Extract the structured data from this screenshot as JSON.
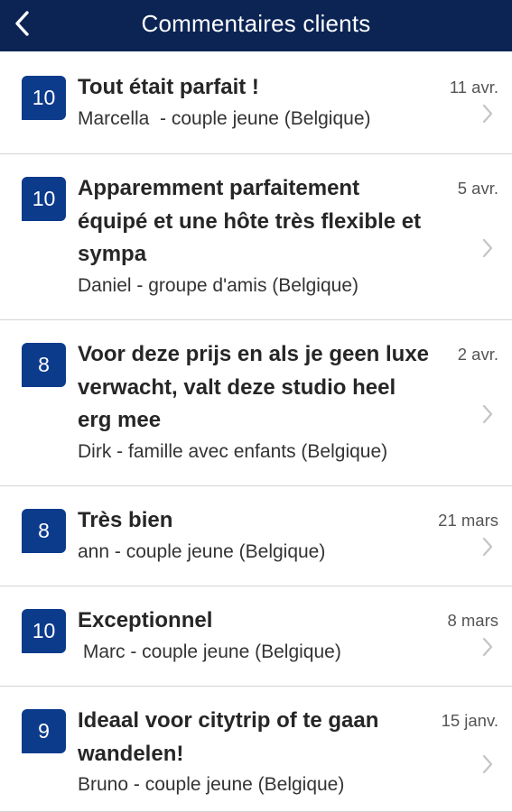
{
  "header": {
    "title": "Commentaires clients",
    "back_icon": "chevron-left-icon"
  },
  "colors": {
    "header_bg": "#0b2454",
    "score_bg": "#0d3b8c"
  },
  "reviews": [
    {
      "score": "10",
      "title": "Tout était parfait !",
      "author": "Marcella  - couple jeune (Belgique)",
      "date": "11 avr."
    },
    {
      "score": "10",
      "title": "Apparemment parfaitement équipé et une hôte très flexible et sympa",
      "author": "Daniel - groupe d'amis (Belgique)",
      "date": "5 avr."
    },
    {
      "score": "8",
      "title": "Voor deze prijs en als je geen luxe verwacht, valt deze studio heel erg mee",
      "author": "Dirk - famille avec enfants (Belgique)",
      "date": "2 avr."
    },
    {
      "score": "8",
      "title": "Très bien",
      "author": "ann - couple jeune (Belgique)",
      "date": "21 mars"
    },
    {
      "score": "10",
      "title": "Exceptionnel",
      "author": " Marc - couple jeune (Belgique)",
      "date": "8 mars"
    },
    {
      "score": "9",
      "title": "Ideaal voor citytrip of te gaan wandelen!",
      "author": "Bruno - couple jeune (Belgique)",
      "date": "15 janv."
    }
  ]
}
